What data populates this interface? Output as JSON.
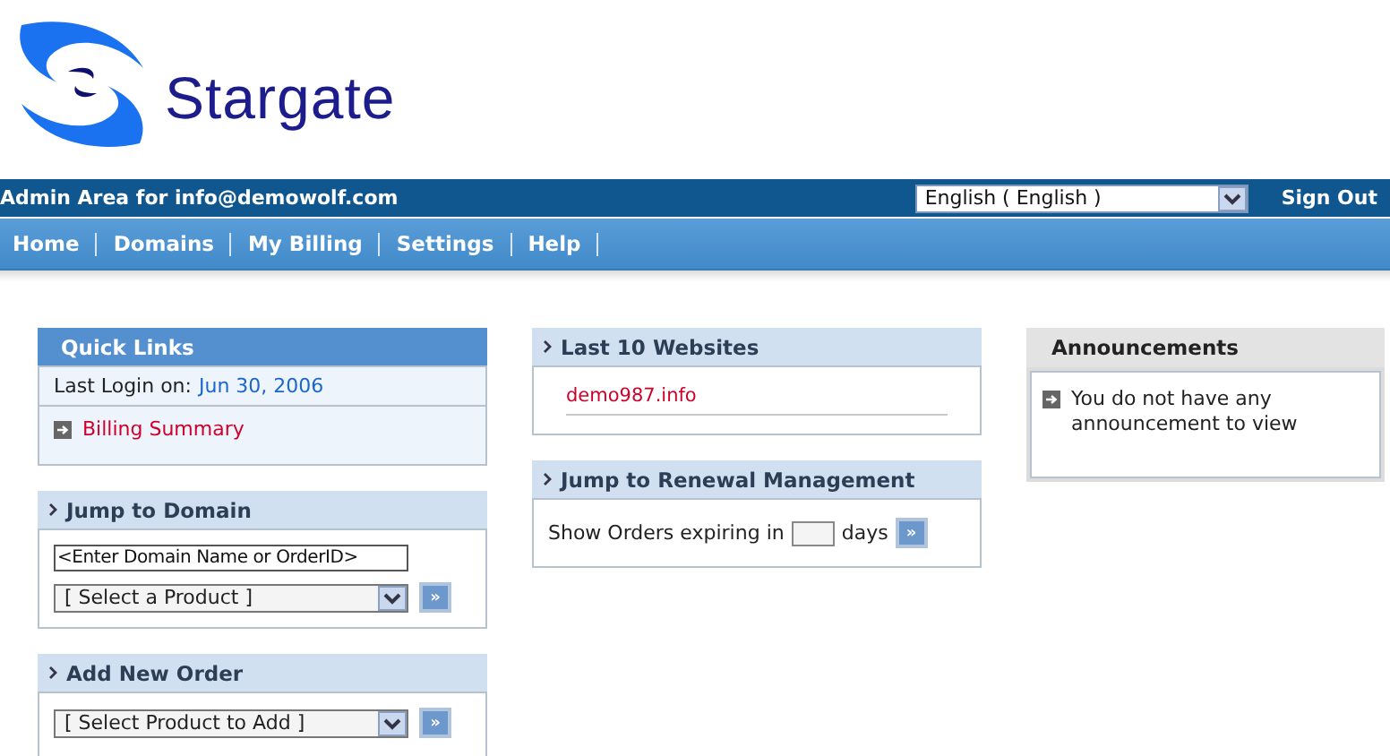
{
  "logo": {
    "name": "Stargate"
  },
  "admin_bar": {
    "text": "Admin Area for info@demowolf.com",
    "language": "English ( English )",
    "sign_out": "Sign Out"
  },
  "nav": [
    "Home",
    "Domains",
    "My Billing",
    "Settings",
    "Help"
  ],
  "columns": [
    {
      "panels": [
        {
          "kind": "quick_links",
          "title": "Quick Links",
          "last_login_label": "Last Login on:",
          "last_login_date": "Jun 30, 2006",
          "links": [
            "Billing Summary"
          ]
        },
        {
          "kind": "jump_domain",
          "title": "Jump to Domain",
          "field_value": "<Enter Domain Name or OrderID>",
          "select": "[ Select a Product ]",
          "go": "»"
        },
        {
          "kind": "add_order",
          "title": "Add New Order",
          "select": "[ Select Product to Add ]",
          "go": "»"
        }
      ]
    },
    {
      "panels": [
        {
          "kind": "websites",
          "title": "Last 10 Websites",
          "links": [
            "demo987.info"
          ]
        },
        {
          "kind": "renewal",
          "title": "Jump to Renewal Management",
          "label": "Show Orders expiring in",
          "unit": "days",
          "go": "»"
        }
      ]
    },
    {
      "panels": [
        {
          "kind": "announcements",
          "title": "Announcements",
          "text": "You do not have any announcement to view"
        }
      ]
    }
  ]
}
